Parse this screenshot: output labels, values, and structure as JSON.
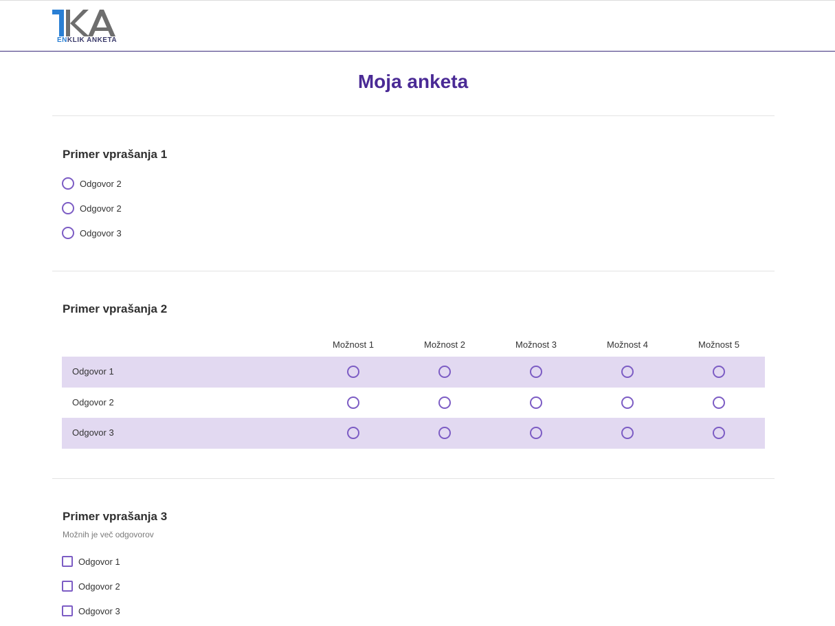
{
  "brand": {
    "logo_mark": "1KA",
    "logo_caption_accent": "EN",
    "logo_caption_rest": "KLIK ANKETA",
    "colors": {
      "blue": "#2a7fd4",
      "gray": "#6e6e6e"
    }
  },
  "survey_title": "Moja anketa",
  "accent_color": "#7c5cc4",
  "question1": {
    "title": "Primer vprašanja 1",
    "options": [
      "Odgovor 2",
      "Odgovor 2",
      "Odgovor 3"
    ]
  },
  "question2": {
    "title": "Primer vprašanja 2",
    "columns": [
      "Možnost 1",
      "Možnost 2",
      "Možnost 3",
      "Možnost 4",
      "Možnost 5"
    ],
    "rows": [
      "Odgovor 1",
      "Odgovor 2",
      "Odgovor 3"
    ]
  },
  "question3": {
    "title": "Primer vprašanja 3",
    "note": "Možnih je več odgovorov",
    "options": [
      "Odgovor 1",
      "Odgovor 2",
      "Odgovor 3"
    ]
  }
}
